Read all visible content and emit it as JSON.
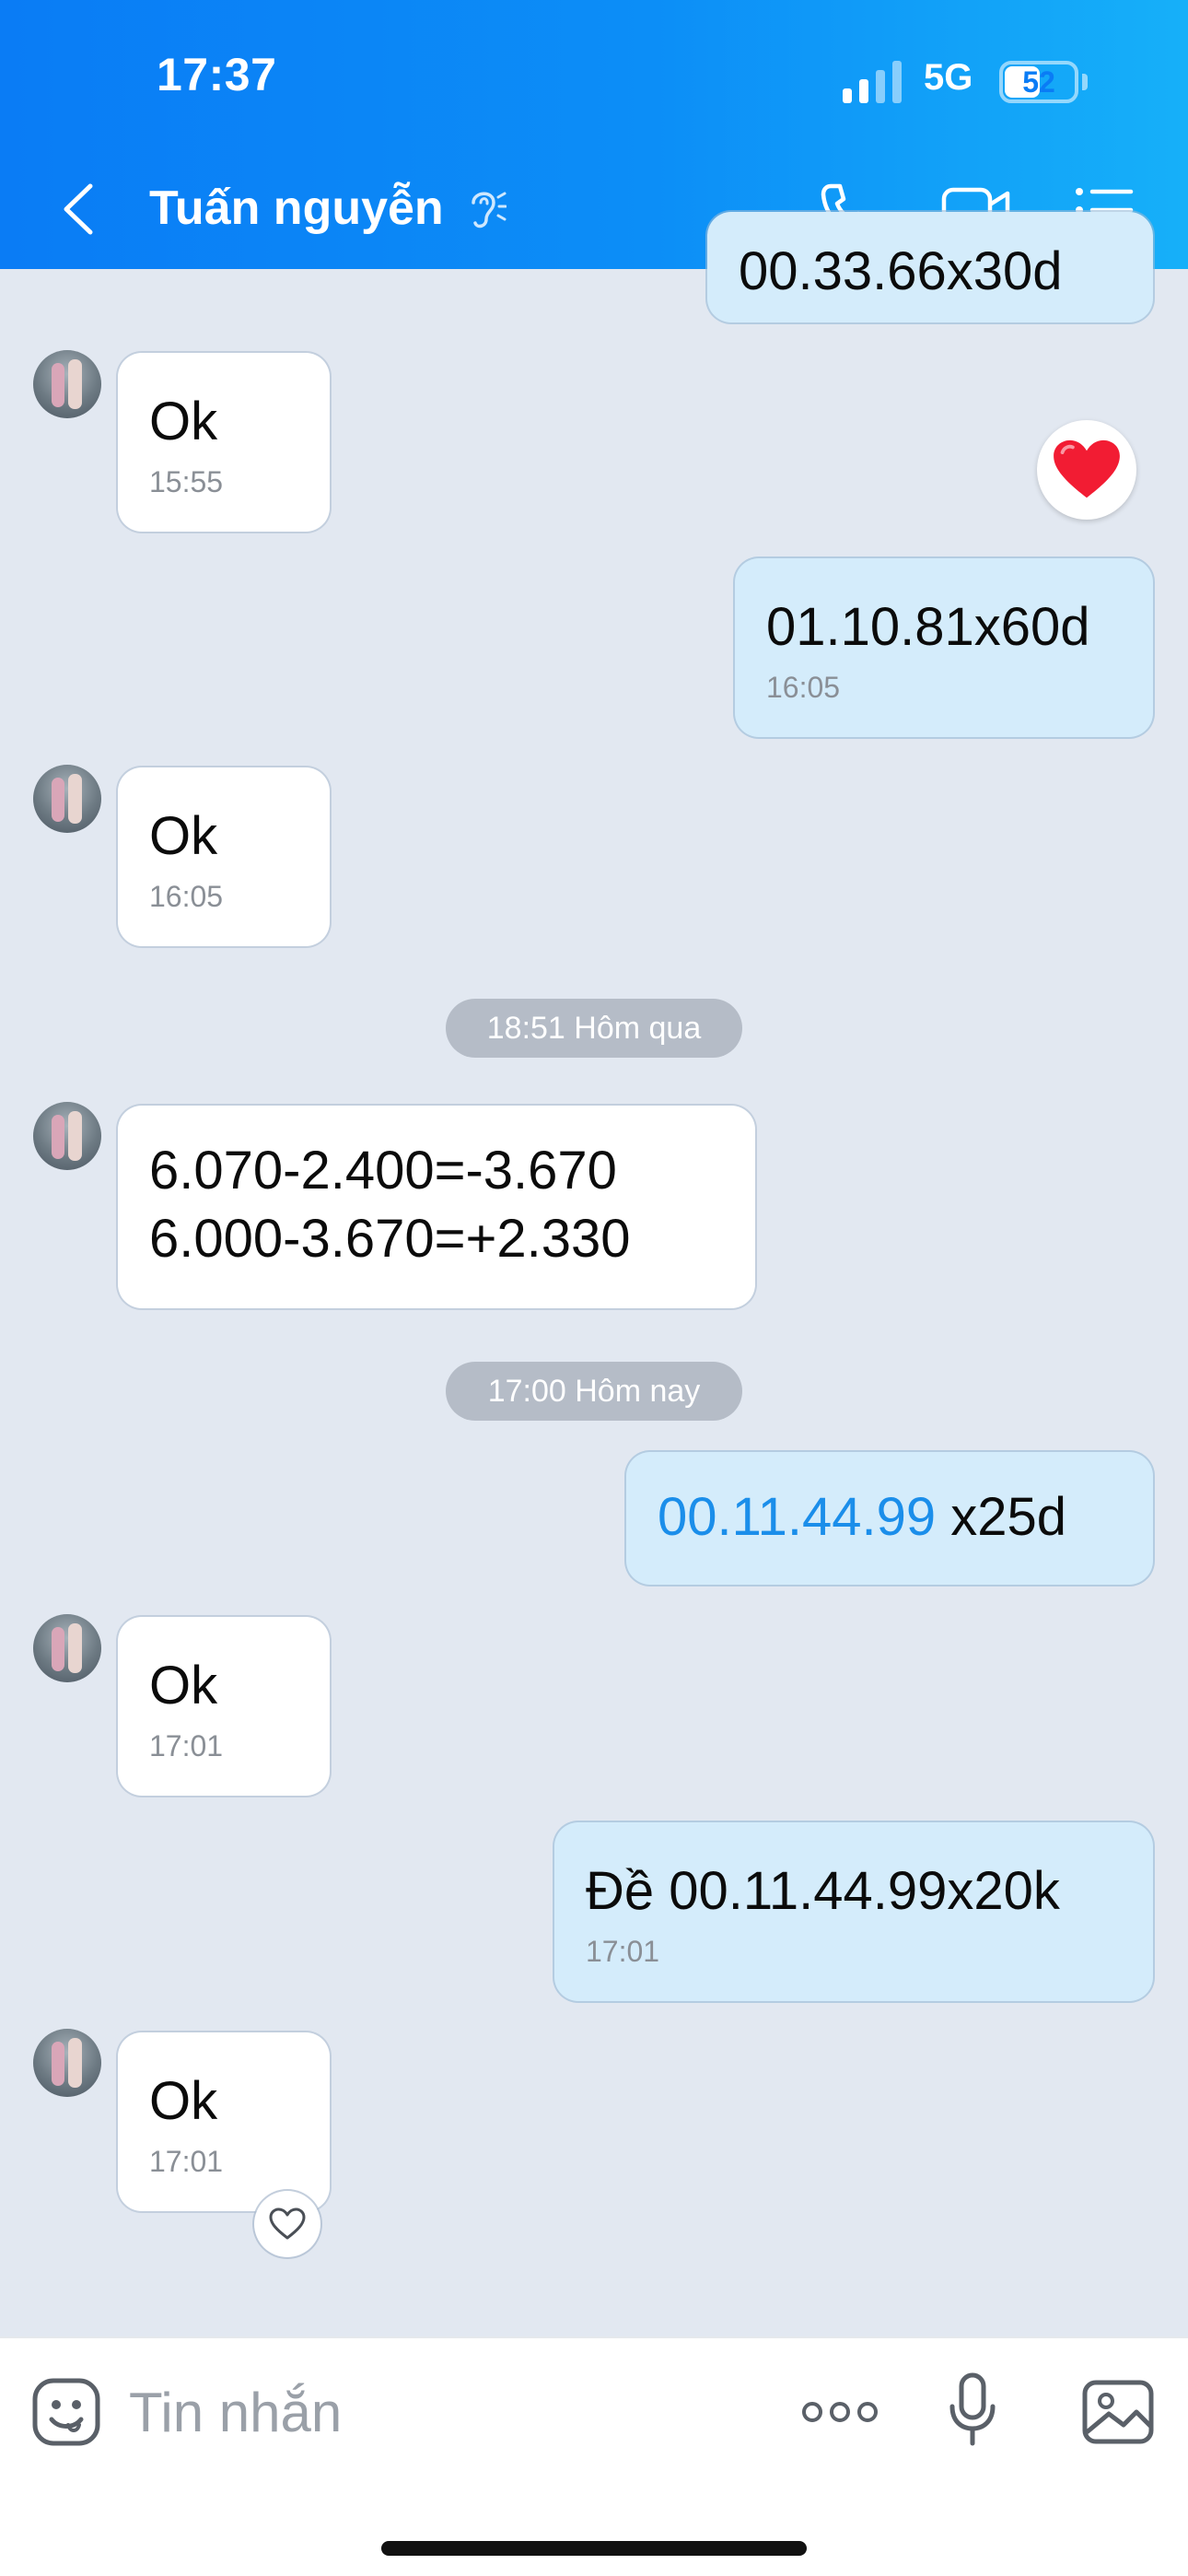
{
  "status_bar": {
    "time": "17:37",
    "network": "5G",
    "battery_level": "52",
    "battery_fraction": 0.52
  },
  "header": {
    "contact_name": "Tuấn nguyễn",
    "icons": [
      "back-icon",
      "ear-icon",
      "phone-icon",
      "video-icon",
      "menu-icon"
    ]
  },
  "chat": {
    "partial_top_text": "00.33.66x30d",
    "messages": [
      {
        "direction": "in",
        "text": "Ok",
        "time": "15:55"
      },
      {
        "direction": "out",
        "text": "01.10.81x60d",
        "time": "16:05"
      },
      {
        "direction": "in",
        "text": "Ok",
        "time": "16:05"
      },
      {
        "direction": "in",
        "line1": "6.070-2.400=-3.670",
        "line2": "6.000-3.670=+2.330"
      },
      {
        "direction": "out",
        "link_text": "00.11.44.99",
        "text": " x25d"
      },
      {
        "direction": "in",
        "text": "Ok",
        "time": "17:01"
      },
      {
        "direction": "out",
        "text": "Đề 00.11.44.99x20k",
        "time": "17:01"
      },
      {
        "direction": "in",
        "text": "Ok",
        "time": "17:01"
      }
    ],
    "date_separators": [
      "18:51 Hôm qua",
      "17:00 Hôm nay"
    ],
    "reactions": [
      "heart-filled-icon",
      "heart-outline-icon"
    ]
  },
  "input_bar": {
    "placeholder": "Tin nhắn",
    "icons": [
      "emoji-icon",
      "more-icon",
      "mic-icon",
      "image-icon"
    ]
  },
  "colors": {
    "header_start": "#0a7cf5",
    "header_end": "#16b0f9",
    "chat_background": "#e2e8f1",
    "outgoing_bubble": "#d4ecfb",
    "incoming_bubble": "#ffffff",
    "link": "#1b8eea"
  }
}
